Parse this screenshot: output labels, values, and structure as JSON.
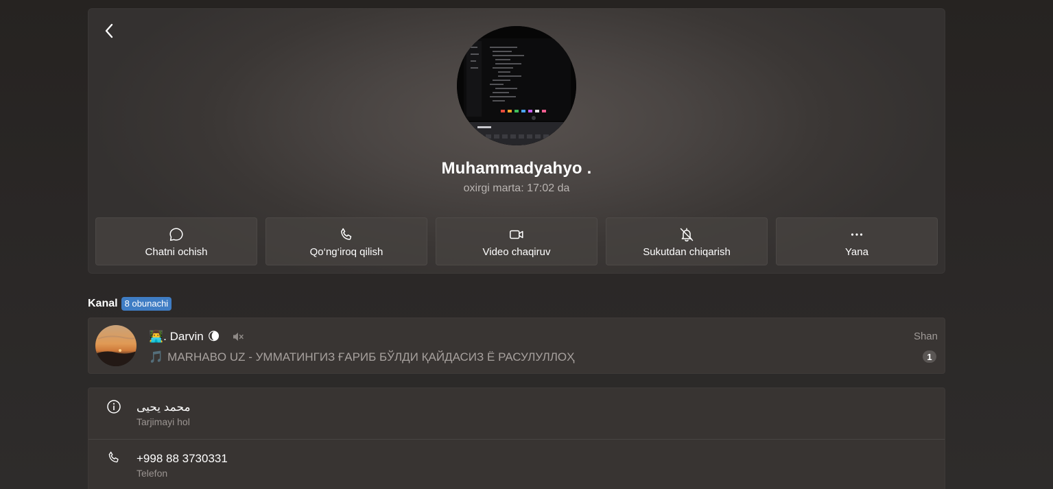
{
  "profile": {
    "name": "Muhammadyahyo .",
    "status": "oxirgi marta: 17:02 da"
  },
  "actions": [
    {
      "label": "Chatni ochish",
      "icon": "chat-bubble-icon"
    },
    {
      "label": "Qo‘ng‘iroq qilish",
      "icon": "phone-icon"
    },
    {
      "label": "Video chaqiruv",
      "icon": "video-camera-icon"
    },
    {
      "label": "Sukutdan chiqarish",
      "icon": "bell-off-icon"
    },
    {
      "label": "Yana",
      "icon": "more-horizontal-icon"
    }
  ],
  "channel_section": {
    "title": "Kanal",
    "badge": "8 obunachi"
  },
  "channel": {
    "title_prefix": "👨‍💻",
    "title": ". Darvin",
    "title_suffix": "🌘",
    "last_message_icon": "🎵",
    "last_message": "MARHABO UZ - УММАТИНГИЗ ҒАРИБ БЎЛДИ ҚАЙДАСИЗ Ё РАСУЛУЛЛОҲ",
    "time": "Shan",
    "unread": "1",
    "muted": true
  },
  "info": [
    {
      "value": "محمد یحیی",
      "label": "Tarjimayi hol",
      "icon": "info-icon"
    },
    {
      "value": "+998 88 3730331",
      "label": "Telefon",
      "icon": "phone-icon"
    }
  ],
  "colors": {
    "badge": "#3f7dc4",
    "background": "#2a2726",
    "card": "#393533"
  }
}
